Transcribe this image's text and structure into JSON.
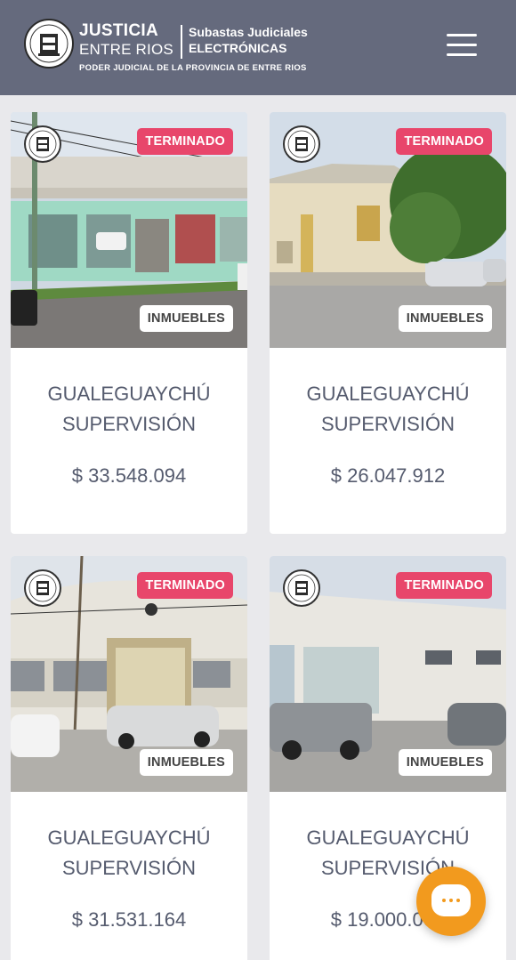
{
  "header": {
    "brand_title": "JUSTICIA",
    "brand_subtitle": "ENTRE RIOS",
    "section_line1": "Subastas Judiciales",
    "section_line2": "ELECTRÓNICAS",
    "tagline": "PODER JUDICIAL DE LA PROVINCIA DE ENTRE RIOS",
    "menu_icon": "hamburger-menu-icon"
  },
  "listings": [
    {
      "status": "TERMINADO",
      "category": "INMUEBLES",
      "title_line1": "GUALEGUAYCHÚ",
      "title_line2": "SUPERVISIÓN",
      "price": "$ 33.548.094"
    },
    {
      "status": "TERMINADO",
      "category": "INMUEBLES",
      "title_line1": "GUALEGUAYCHÚ",
      "title_line2": "SUPERVISIÓN",
      "price": "$ 26.047.912"
    },
    {
      "status": "TERMINADO",
      "category": "INMUEBLES",
      "title_line1": "GUALEGUAYCHÚ",
      "title_line2": "SUPERVISIÓN",
      "price": "$ 31.531.164"
    },
    {
      "status": "TERMINADO",
      "category": "INMUEBLES",
      "title_line1": "GUALEGUAYCHÚ",
      "title_line2": "SUPERVISIÓN",
      "price": "$ 19.000.000"
    }
  ],
  "chat": {
    "icon": "chat-bubble-icon"
  },
  "colors": {
    "header_bg": "#656a7d",
    "status_badge": "#e8466b",
    "chat_button": "#f29a1e",
    "text": "#555b6e"
  }
}
